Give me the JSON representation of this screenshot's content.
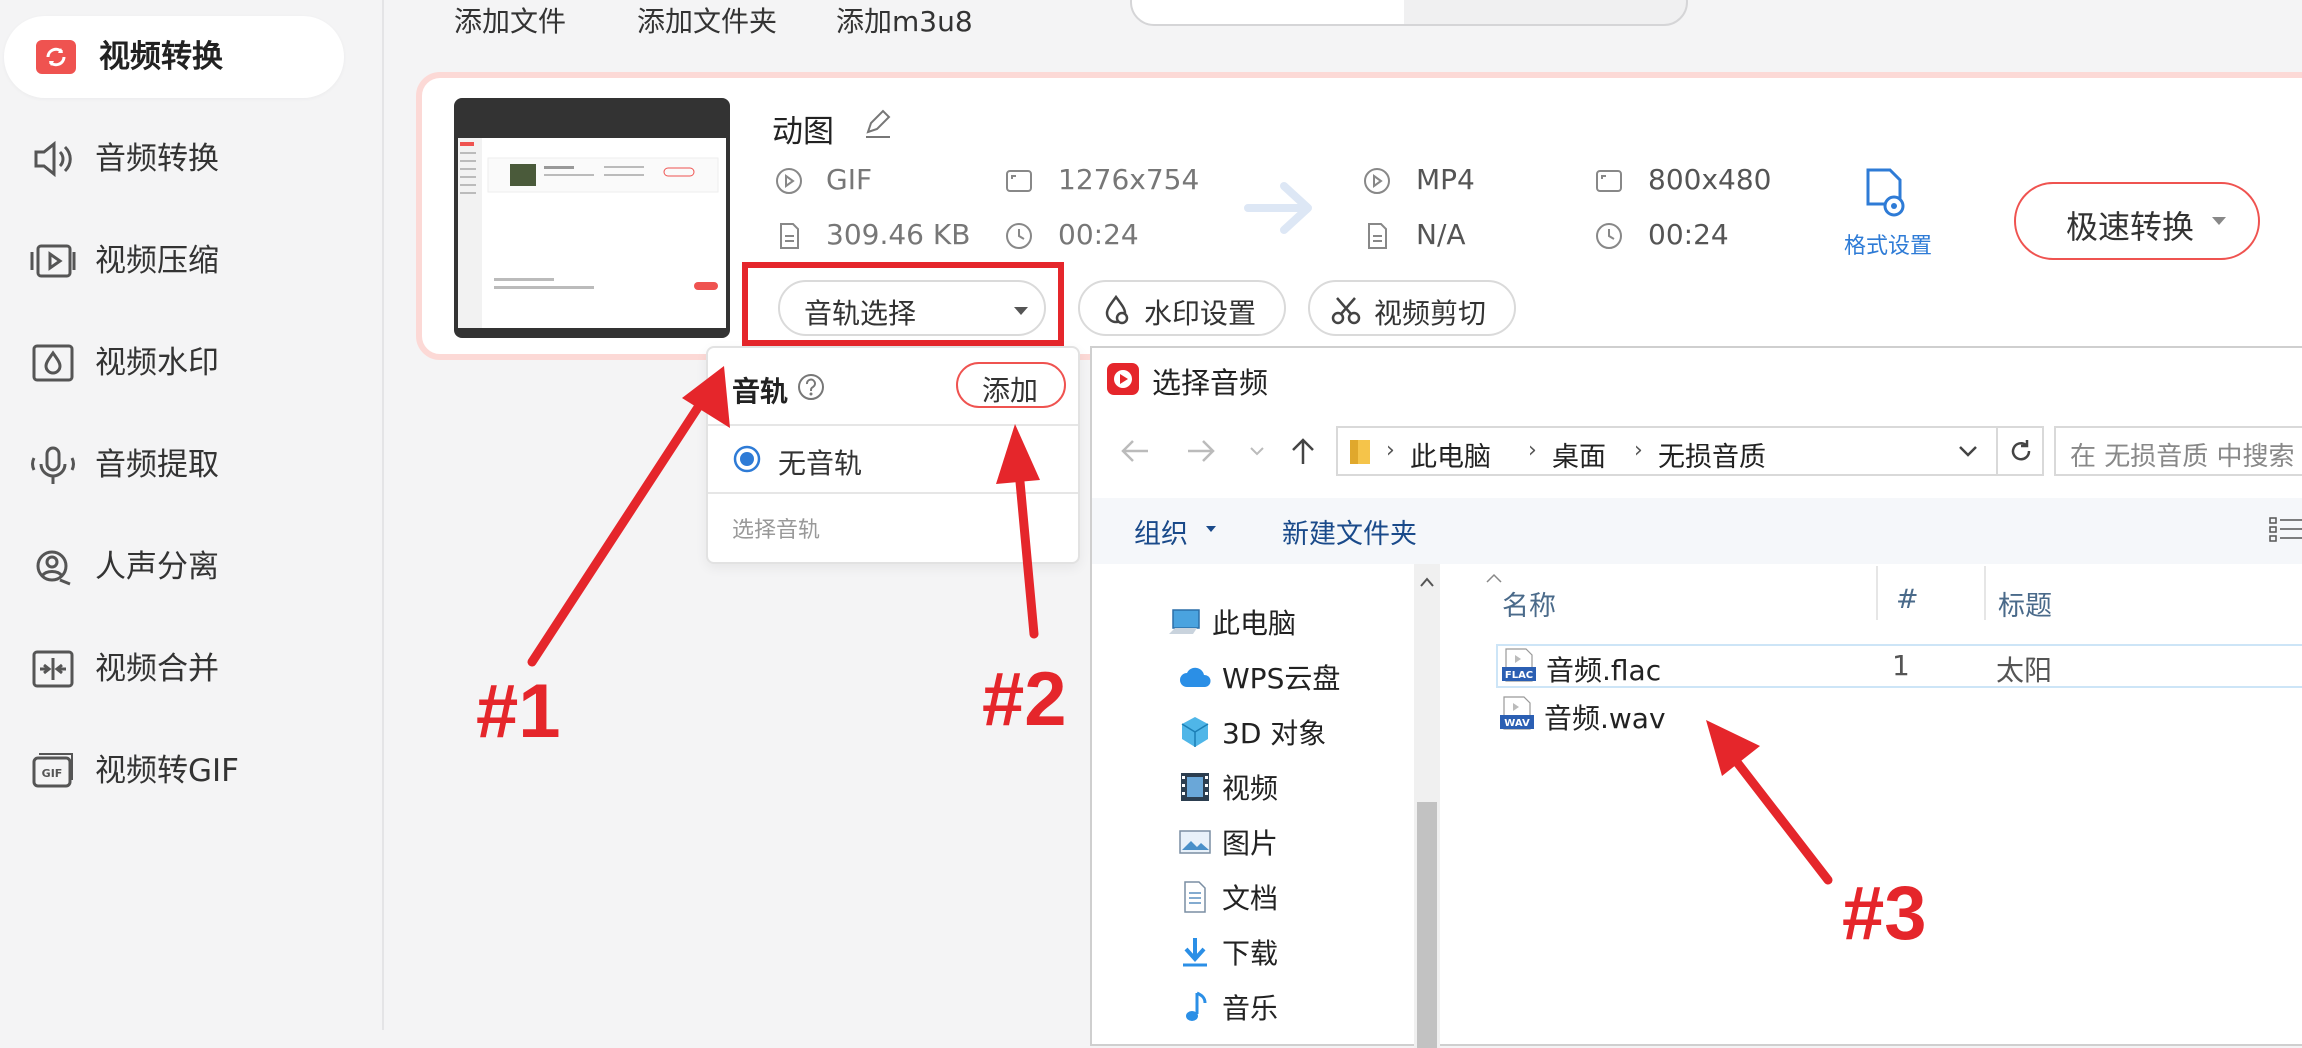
{
  "sidebar": {
    "items": [
      {
        "label": "视频转换",
        "icon": "video-convert-icon",
        "active": true
      },
      {
        "label": "音频转换",
        "icon": "audio-convert-icon"
      },
      {
        "label": "视频压缩",
        "icon": "video-compress-icon"
      },
      {
        "label": "视频水印",
        "icon": "video-watermark-icon"
      },
      {
        "label": "音频提取",
        "icon": "audio-extract-icon"
      },
      {
        "label": "人声分离",
        "icon": "vocal-separate-icon"
      },
      {
        "label": "视频合并",
        "icon": "video-merge-icon"
      },
      {
        "label": "视频转GIF",
        "icon": "video-to-gif-icon"
      }
    ]
  },
  "toolbar": {
    "add_file": "添加文件",
    "add_folder": "添加文件夹",
    "add_m3u8": "添加m3u8"
  },
  "file_card": {
    "name": "动图",
    "source": {
      "format": "GIF",
      "resolution": "1276x754",
      "size": "309.46 KB",
      "duration": "00:24"
    },
    "target": {
      "format": "MP4",
      "resolution": "800x480",
      "size": "N/A",
      "duration": "00:24"
    },
    "format_settings": "格式设置",
    "convert_button": "极速转换",
    "audio_track_select": "音轨选择",
    "watermark_button": "水印设置",
    "trim_button": "视频剪切"
  },
  "audio_dropdown": {
    "title": "音轨",
    "add_button": "添加",
    "option_none": "无音轨",
    "hint": "选择音轨"
  },
  "file_dialog": {
    "title": "选择音频",
    "breadcrumb": [
      "此电脑",
      "桌面",
      "无损音质"
    ],
    "search_placeholder": "在 无损音质 中搜索",
    "organize": "组织",
    "new_folder": "新建文件夹",
    "tree": [
      "此电脑",
      "WPS云盘",
      "3D 对象",
      "视频",
      "图片",
      "文档",
      "下载",
      "音乐"
    ],
    "columns": {
      "name": "名称",
      "num": "#",
      "title": "标题"
    },
    "files": [
      {
        "name": "音频.flac",
        "badge": "FLAC",
        "num": "1",
        "title": "太阳"
      },
      {
        "name": "音频.wav",
        "badge": "WAV",
        "num": "",
        "title": ""
      }
    ]
  },
  "annotations": {
    "a1": "#1",
    "a2": "#2",
    "a3": "#3"
  },
  "colors": {
    "accent": "#ef5350",
    "annotation": "#e5262b",
    "link": "#2e7bd6"
  }
}
